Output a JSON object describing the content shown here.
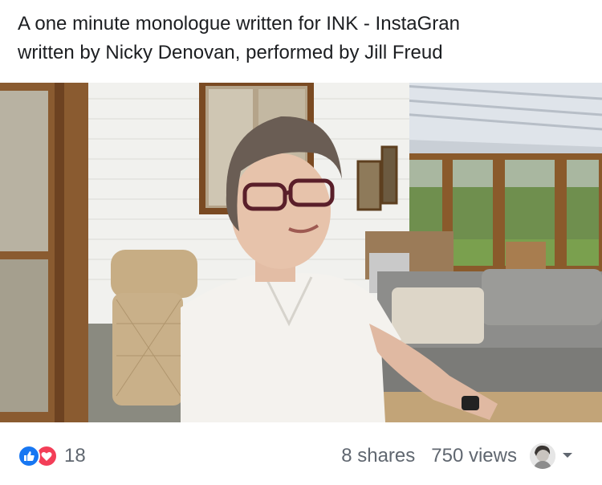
{
  "post": {
    "caption_line1": "A one minute monologue written for INK - InstaGran",
    "caption_line2": "written by Nicky Denovan, performed by Jill Freud"
  },
  "video": {
    "sound_icon": "speaker-icon"
  },
  "footer": {
    "reaction_icons": [
      "like-icon",
      "love-icon"
    ],
    "reaction_count": "18",
    "shares": "8 shares",
    "views": "750 views",
    "colors": {
      "like": "#1877f2",
      "love": "#f33e58",
      "muted_text": "#606770"
    }
  }
}
